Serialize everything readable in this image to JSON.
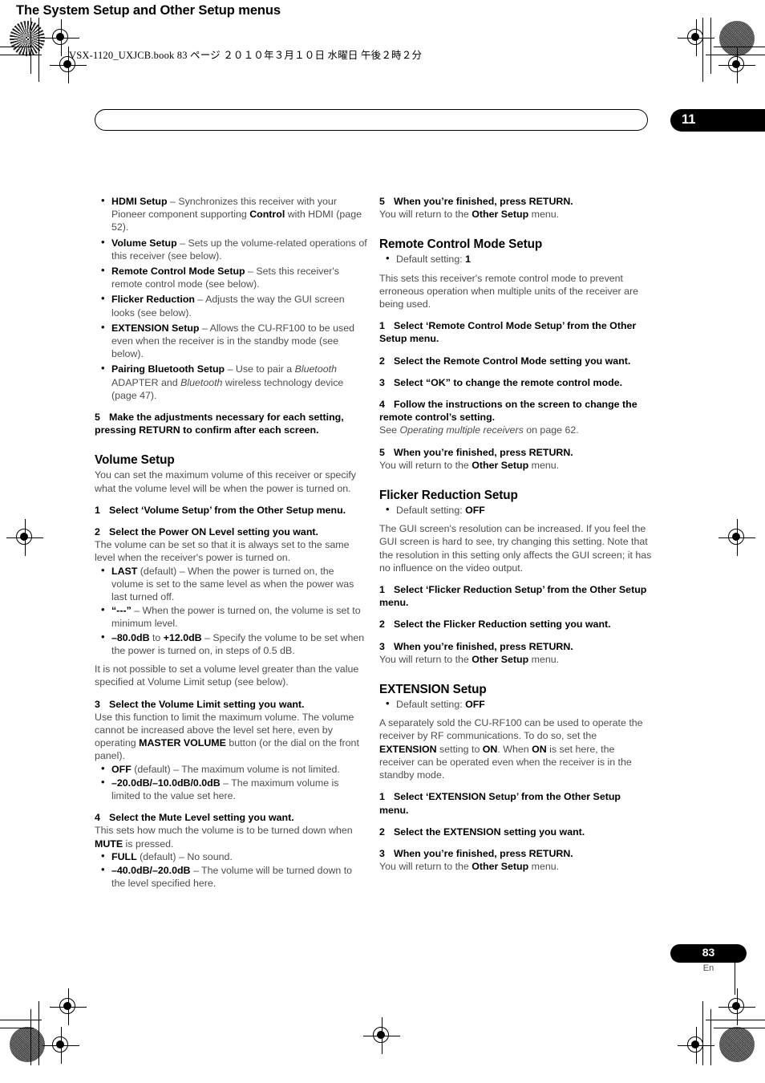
{
  "print_header": {
    "text": "VSX-1120_UXJCB.book   83 ページ   ２０１０年３月１０日   水曜日   午後２時２分"
  },
  "chapter": {
    "title": "The System Setup and Other Setup menus",
    "number": "11"
  },
  "footer": {
    "page_number": "83",
    "language": "En"
  },
  "left_column": {
    "menu_bullets": [
      {
        "term": "HDMI Setup",
        "dash": " – ",
        "desc_1": "Synchronizes this receiver with your Pioneer component supporting ",
        "bold_2": "Control",
        "desc_2": " with HDMI (page 52)."
      },
      {
        "term": "Volume Setup",
        "dash": " – ",
        "desc_1": "Sets up the volume-related operations of this receiver (see below)."
      },
      {
        "term": "Remote Control Mode Setup",
        "dash": " – ",
        "desc_1": "Sets this receiver's remote control mode (see below)."
      },
      {
        "term": "Flicker Reduction",
        "dash": " – ",
        "desc_1": "Adjusts the way the GUI screen looks (see below)."
      },
      {
        "term": "EXTENSION Setup",
        "dash": " – ",
        "desc_1": "Allows the CU-RF100 to be used even when the receiver is in the standby mode (see below)."
      },
      {
        "term": "Pairing Bluetooth Setup",
        "dash": " – ",
        "desc_1": "Use to pair a ",
        "italic_1": "Bluetooth",
        "desc_2": " ADAPTER and ",
        "italic_2": "Bluetooth",
        "desc_3": " wireless technology device (page 47)."
      }
    ],
    "step_5": {
      "num": "5",
      "text": "Make the adjustments necessary for each setting, pressing RETURN to confirm after each screen."
    },
    "volume_setup": {
      "heading": "Volume Setup",
      "intro": "You can set the maximum volume of this receiver or specify what the volume level will be when the power is turned on.",
      "step_1": {
        "num": "1",
        "text": "Select ‘Volume Setup’ from the Other Setup menu."
      },
      "step_2": {
        "num": "2",
        "text": "Select the Power ON Level setting you want."
      },
      "step_2_body": "The volume can be set so that it is always set to the same level when the receiver's power is turned on.",
      "power_on_options": [
        {
          "term": "LAST",
          "desc": " (default) – When the power is turned on, the volume is set to the same level as when the power was last turned off."
        },
        {
          "term": "“---”",
          "desc": " – When the power is turned on, the volume is set to minimum level."
        },
        {
          "term": "–80.0dB",
          "mid": " to ",
          "term2": "+12.0dB",
          "desc": " – Specify the volume to be set when the power is turned on, in steps of 0.5 dB."
        }
      ],
      "note": "It is not possible to set a volume level greater than the value specified at Volume Limit setup (see below).",
      "step_3": {
        "num": "3",
        "text": "Select the Volume Limit setting you want."
      },
      "step_3_body_1": "Use this function to limit the maximum volume. The volume cannot be increased above the level set here, even by operating ",
      "step_3_bold": "MASTER VOLUME",
      "step_3_body_2": " button (or the dial on the front panel).",
      "volume_limit_options": [
        {
          "term": "OFF",
          "desc": " (default) – The maximum volume is not limited."
        },
        {
          "term": "–20.0dB/–10.0dB/0.0dB",
          "desc": " – The maximum volume is limited to the value set here."
        }
      ],
      "step_4": {
        "num": "4",
        "text": "Select the Mute Level setting you want."
      },
      "step_4_body_1": "This sets how much the volume is to be turned down when ",
      "step_4_bold": "MUTE",
      "step_4_body_2": " is pressed.",
      "mute_options": [
        {
          "term": "FULL",
          "desc": " (default) – No sound."
        },
        {
          "term": "–40.0dB/–20.0dB",
          "desc": " – The volume will be turned down to the level specified here."
        }
      ]
    }
  },
  "right_column": {
    "volume_step_5": {
      "num": "5",
      "text": "When you’re finished, press RETURN."
    },
    "volume_step_5_body_1": "You will return to the ",
    "volume_step_5_bold": "Other Setup",
    "volume_step_5_body_2": " menu.",
    "remote_control": {
      "heading": "Remote Control Mode Setup",
      "default_label": "Default setting: ",
      "default_value": "1",
      "intro": "This sets this receiver's remote control mode to prevent erroneous operation when multiple units of the receiver are being used.",
      "step_1": {
        "num": "1",
        "text": "Select ‘Remote Control Mode Setup’ from the Other Setup menu."
      },
      "step_2": {
        "num": "2",
        "text": "Select the Remote Control Mode setting you want."
      },
      "step_3": {
        "num": "3",
        "text": "Select “OK” to change the remote control mode."
      },
      "step_4": {
        "num": "4",
        "text": "Follow the instructions on the screen to change the remote control’s setting."
      },
      "step_4_body_1": "See ",
      "step_4_italic": "Operating multiple receivers",
      "step_4_body_2": " on page 62.",
      "step_5": {
        "num": "5",
        "text": "When you’re finished, press RETURN."
      },
      "step_5_body_1": "You will return to the ",
      "step_5_bold": "Other Setup",
      "step_5_body_2": " menu."
    },
    "flicker_reduction": {
      "heading": "Flicker Reduction Setup",
      "default_label": "Default setting: ",
      "default_value": "OFF",
      "intro": "The GUI screen's resolution can be increased. If you feel the GUI screen is hard to see, try changing this setting. Note that the resolution in this setting only affects the GUI screen; it has no influence on the video output.",
      "step_1": {
        "num": "1",
        "text": "Select ‘Flicker Reduction Setup’ from the Other Setup menu."
      },
      "step_2": {
        "num": "2",
        "text": "Select the Flicker Reduction setting you want."
      },
      "step_3": {
        "num": "3",
        "text": "When you’re finished, press RETURN."
      },
      "step_3_body_1": "You will return to the ",
      "step_3_bold": "Other Setup",
      "step_3_body_2": " menu."
    },
    "extension": {
      "heading": "EXTENSION Setup",
      "default_label": "Default setting: ",
      "default_value": "OFF",
      "intro_1": "A separately sold the CU-RF100 can be used to operate the receiver by RF communications. To do so, set the ",
      "intro_bold_1": "EXTENSION",
      "intro_2": " setting to ",
      "intro_bold_2": "ON",
      "intro_3": ". When ",
      "intro_bold_3": "ON",
      "intro_4": " is set here, the receiver can be operated even when the receiver is in the standby mode.",
      "step_1": {
        "num": "1",
        "text": "Select ‘EXTENSION Setup’ from the Other Setup menu."
      },
      "step_2": {
        "num": "2",
        "text": "Select the EXTENSION setting you want."
      },
      "step_3": {
        "num": "3",
        "text": "When you’re finished, press RETURN."
      },
      "step_3_body_1": "You will return to the ",
      "step_3_bold": "Other Setup",
      "step_3_body_2": " menu."
    }
  }
}
